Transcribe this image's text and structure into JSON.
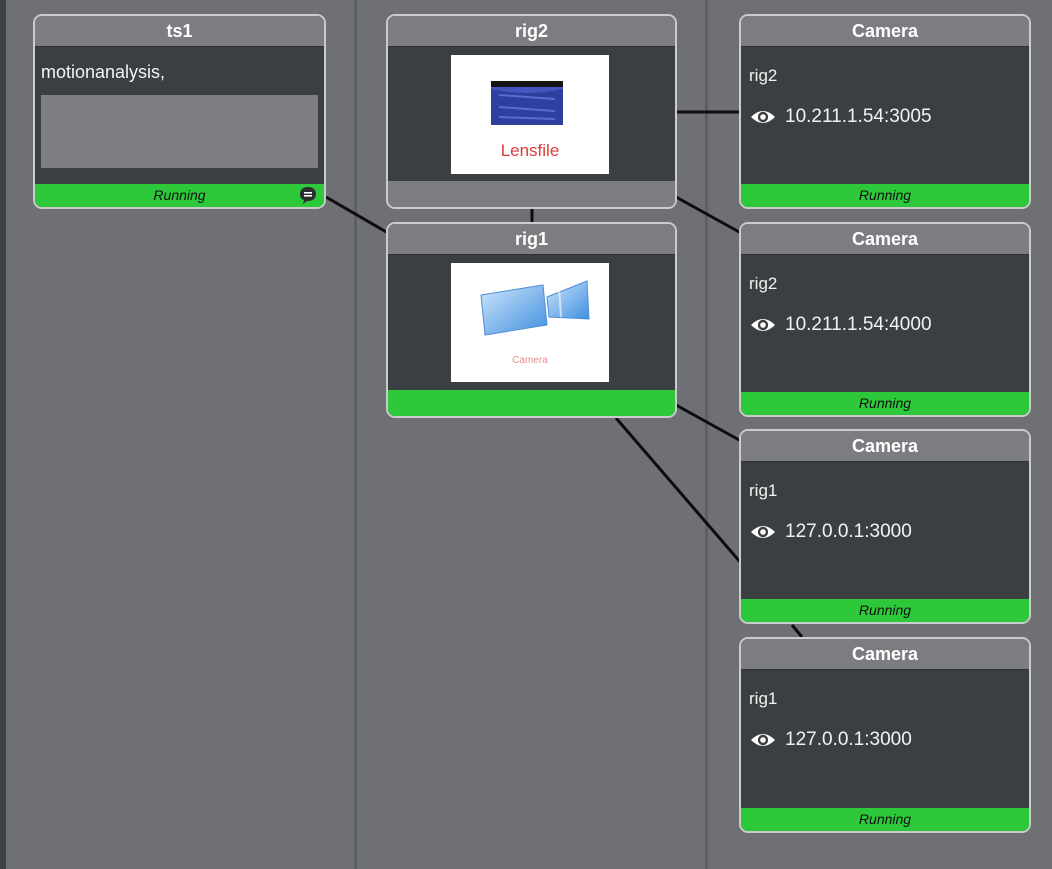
{
  "colors": {
    "running": "#2ec93a",
    "header": "#7b7d80",
    "node_body": "#3c3f42",
    "canvas": "#6e7074"
  },
  "ts1": {
    "title": "ts1",
    "text": "motionanalysis,",
    "status": "Running",
    "icon": "chat-bubble-icon"
  },
  "rig2": {
    "title": "rig2",
    "image_label": "Lensfile",
    "status": ""
  },
  "rig1": {
    "title": "rig1",
    "image_label": "Camera",
    "status": ""
  },
  "cameras": [
    {
      "title": "Camera",
      "role": "rig2",
      "address": "10.211.1.54:3005",
      "status": "Running",
      "icon": "eye-icon"
    },
    {
      "title": "Camera",
      "role": "rig2",
      "address": "10.211.1.54:4000",
      "status": "Running",
      "icon": "eye-icon"
    },
    {
      "title": "Camera",
      "role": "rig1",
      "address": "127.0.0.1:3000",
      "status": "Running",
      "icon": "eye-icon"
    },
    {
      "title": "Camera",
      "role": "rig1",
      "address": "127.0.0.1:3000",
      "status": "Running",
      "icon": "eye-icon"
    }
  ]
}
